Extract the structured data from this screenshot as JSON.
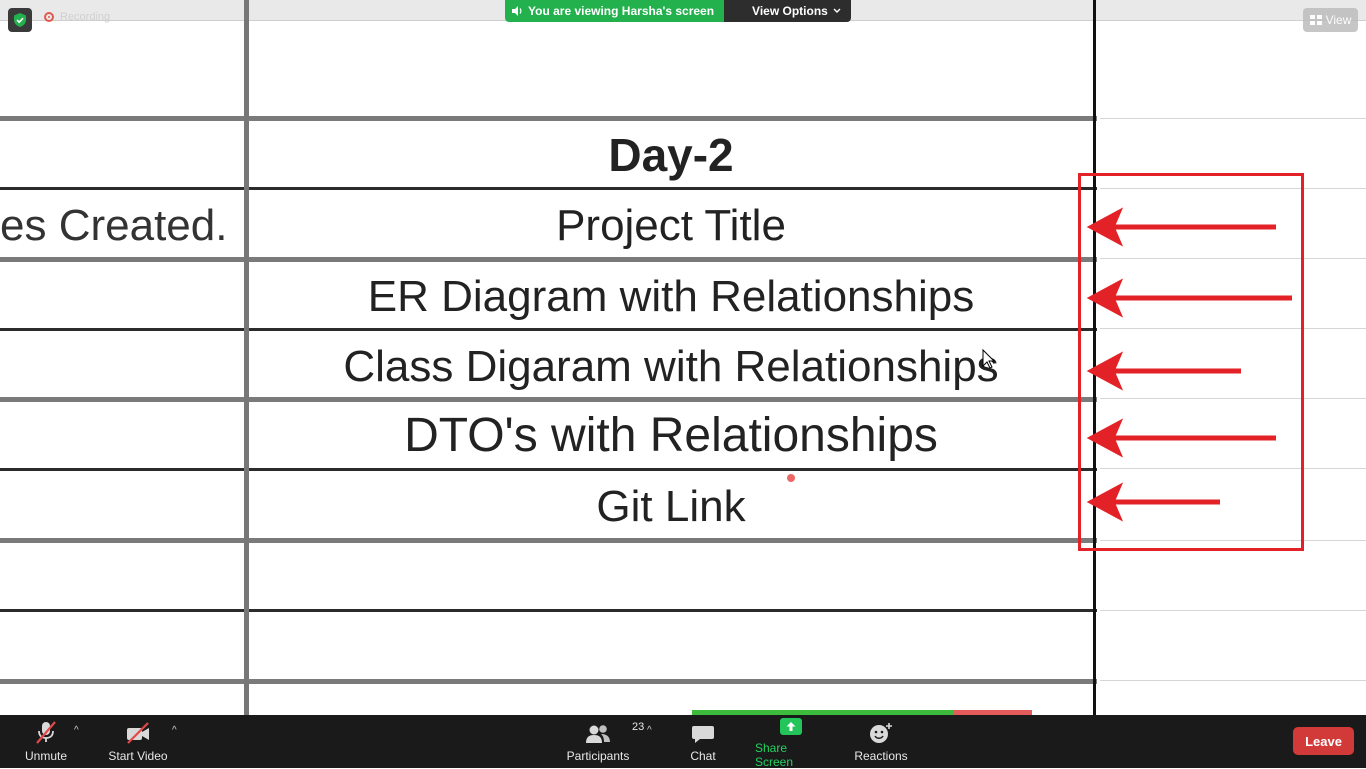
{
  "overlay": {
    "recording_label": "Recording",
    "viewing_text": "You are viewing Harsha's screen",
    "view_options_label": "View Options",
    "view_label": "View"
  },
  "sheet": {
    "day_heading": "Day-2",
    "left_fragment": "es Created.",
    "rows": [
      "Project Title",
      "ER Diagram with Relationships",
      "Class Digaram with Relationships",
      "DTO's with Relationships",
      "Git Link"
    ]
  },
  "toolbar": {
    "unmute_label": "Unmute",
    "start_video_label": "Start Video",
    "participants_label": "Participants",
    "participants_count": "23",
    "chat_label": "Chat",
    "share_screen_label": "Share Screen",
    "reactions_label": "Reactions",
    "leave_label": "Leave"
  },
  "colors": {
    "annotation_red": "#e32227",
    "share_green": "#23d160",
    "leave_red": "#d23a3a",
    "toolbar_bg": "#1a1a1a"
  }
}
